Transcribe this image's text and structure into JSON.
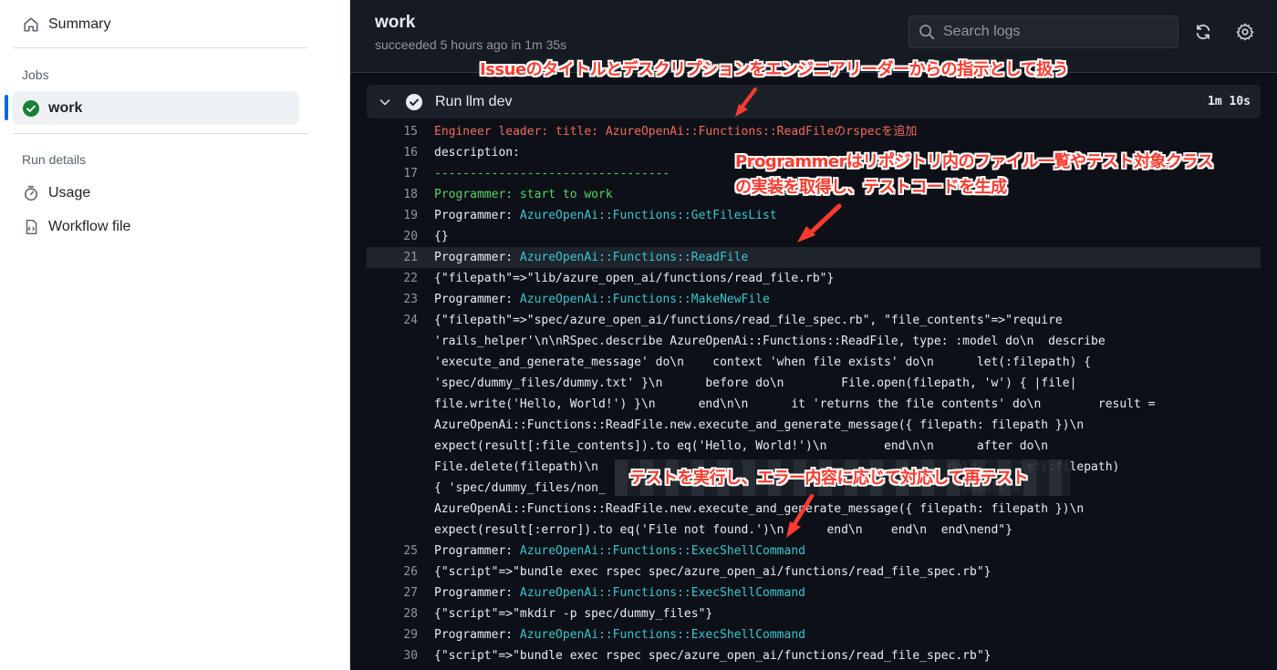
{
  "sidebar": {
    "summary_label": "Summary",
    "jobs_heading": "Jobs",
    "job_item_label": "work",
    "run_details_heading": "Run details",
    "usage_label": "Usage",
    "workflow_file_label": "Workflow file"
  },
  "header": {
    "title": "work",
    "subtitle": "succeeded 5 hours ago in 1m 35s",
    "search_placeholder": "Search logs"
  },
  "step": {
    "name": "Run llm dev",
    "duration": "1m 10s"
  },
  "log": {
    "line15": {
      "num": "15",
      "text": "Engineer leader: title: AzureOpenAi::Functions::ReadFileのrspecを追加"
    },
    "line16": {
      "num": "16",
      "text": "description:"
    },
    "line17": {
      "num": "17",
      "text": "---------------------------------"
    },
    "line18": {
      "num": "18",
      "text": "Programmer: start to work"
    },
    "line19": {
      "num": "19",
      "prefix": "Programmer: ",
      "link": "AzureOpenAi::Functions::GetFilesList"
    },
    "line20": {
      "num": "20",
      "text": "{}"
    },
    "line21": {
      "num": "21",
      "prefix": "Programmer: ",
      "link": "AzureOpenAi::Functions::ReadFile"
    },
    "line22": {
      "num": "22",
      "text": "{\"filepath\"=>\"lib/azure_open_ai/functions/read_file.rb\"}"
    },
    "line23": {
      "num": "23",
      "prefix": "Programmer: ",
      "link": "AzureOpenAi::Functions::MakeNewFile"
    },
    "line24": {
      "num": "24",
      "rows": [
        "{\"filepath\"=>\"spec/azure_open_ai/functions/read_file_spec.rb\", \"file_contents\"=>\"require",
        "'rails_helper'\\n\\nRSpec.describe AzureOpenAi::Functions::ReadFile, type: :model do\\n  describe",
        "'execute_and_generate_message' do\\n    context 'when file exists' do\\n      let(:filepath) {",
        "'spec/dummy_files/dummy.txt' }\\n      before do\\n        File.open(filepath, 'w') { |file|",
        "file.write('Hello, World!') }\\n      end\\n\\n      it 'returns the file contents' do\\n        result =",
        "AzureOpenAi::Functions::ReadFile.new.execute_and_generate_message({ filepath: filepath })\\n",
        "expect(result[:file_contents]).to eq('Hello, World!')\\n        end\\n\\n      after do\\n",
        "File.delete(filepath)\\n                                                 do\\n      let(:filepath)",
        "{ 'spec/dummy_files/non_                                                  result =",
        "AzureOpenAi::Functions::ReadFile.new.execute_and_generate_message({ filepath: filepath })\\n",
        "expect(result[:error]).to eq('File not found.')\\n      end\\n    end\\n  end\\nend\"}"
      ]
    },
    "line25": {
      "num": "25",
      "prefix": "Programmer: ",
      "link": "AzureOpenAi::Functions::ExecShellCommand"
    },
    "line26": {
      "num": "26",
      "text": "{\"script\"=>\"bundle exec rspec spec/azure_open_ai/functions/read_file_spec.rb\"}"
    },
    "line27": {
      "num": "27",
      "prefix": "Programmer: ",
      "link": "AzureOpenAi::Functions::ExecShellCommand"
    },
    "line28": {
      "num": "28",
      "text": "{\"script\"=>\"mkdir -p spec/dummy_files\"}"
    },
    "line29": {
      "num": "29",
      "prefix": "Programmer: ",
      "link": "AzureOpenAi::Functions::ExecShellCommand"
    },
    "line30": {
      "num": "30",
      "text": "{\"script\"=>\"bundle exec rspec spec/azure_open_ai/functions/read_file_spec.rb\"}"
    }
  },
  "annotations": {
    "a1": "Issueのタイトルとデスクリプションをエンジニアリーダーからの指示として扱う",
    "a2_line1": "Programmerはリポジトリ内のファイル一覧やテスト対象クラス",
    "a2_line2": "の実装を取得し、テストコードを生成",
    "a3": "テストを実行し、エラー内容に応じて対応して再テスト"
  },
  "colors": {
    "accent": "#0969da",
    "success": "#1a7f37",
    "annotation": "#ff3b2f",
    "log_red": "#f0695e",
    "log_green": "#56d364",
    "log_cyan": "#39c5cf"
  }
}
